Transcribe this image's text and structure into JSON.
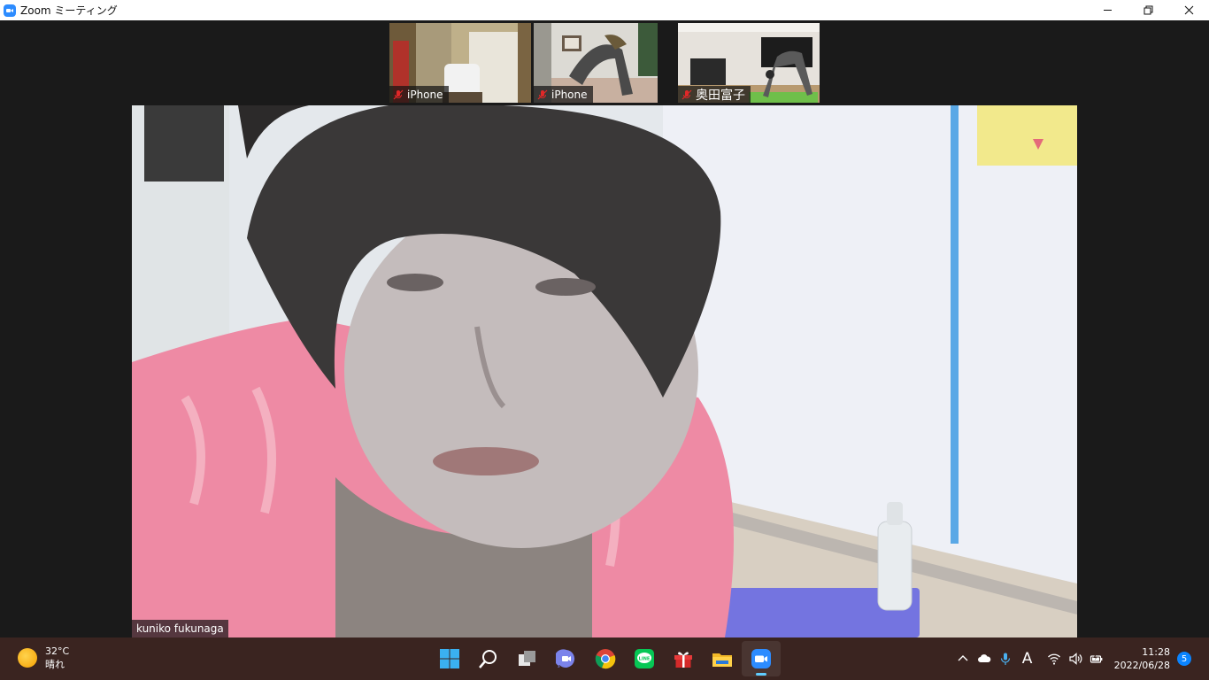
{
  "window": {
    "title": "Zoom ミーティング",
    "app_icon": "zoom-camera-icon",
    "controls": [
      "minimize-icon",
      "restore-icon",
      "close-icon"
    ]
  },
  "thumbnails": [
    {
      "name": "iPhone",
      "muted": true
    },
    {
      "name": "iPhone",
      "muted": true
    },
    {
      "name": "奥田富子",
      "muted": true
    }
  ],
  "main_video": {
    "participant_name": "kuniko fukunaga"
  },
  "taskbar": {
    "weather": {
      "temperature": "32°C",
      "condition": "晴れ",
      "icon": "sun-icon"
    },
    "apps": [
      {
        "name": "start",
        "icon": "windows-start-icon",
        "active": false
      },
      {
        "name": "search",
        "icon": "search-icon",
        "active": false
      },
      {
        "name": "task-view",
        "icon": "task-view-icon",
        "active": false
      },
      {
        "name": "teams-chat",
        "icon": "teams-chat-icon",
        "active": false
      },
      {
        "name": "chrome",
        "icon": "chrome-icon",
        "active": false
      },
      {
        "name": "line",
        "icon": "line-icon",
        "active": false
      },
      {
        "name": "gift",
        "icon": "gift-icon",
        "active": false
      },
      {
        "name": "file-explorer",
        "icon": "folder-icon",
        "active": false
      },
      {
        "name": "zoom",
        "icon": "zoom-icon",
        "active": true
      }
    ],
    "tray": {
      "ime_label": "A",
      "time": "11:28",
      "date": "2022/06/28",
      "notification_count": "5"
    }
  },
  "colors": {
    "zoom_blue": "#2D8CFF",
    "taskbar_bg": "#3a2420",
    "stage_bg": "#1a1a1a",
    "mute_red": "#e02828"
  }
}
